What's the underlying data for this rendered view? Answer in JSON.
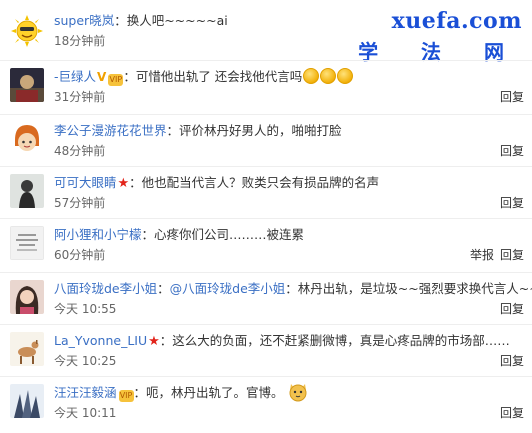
{
  "watermark": {
    "domain": "xuefa.com",
    "chars": "学 法 网"
  },
  "comments": [
    {
      "user": "super晓岚",
      "text": "：换人吧~~~~~ai",
      "time": "18分钟前",
      "reply": "",
      "report": ""
    },
    {
      "user": "-巨绿人",
      "text": "：可惜他出轨了 还会找他代言吗",
      "time": "31分钟前",
      "reply": "回复",
      "report": ""
    },
    {
      "user": "李公子漫游花花世界",
      "text": "：评价林丹好男人的，啪啪打脸",
      "time": "48分钟前",
      "reply": "回复",
      "report": ""
    },
    {
      "user": "可可大眼睛",
      "text": "：他也配当代言人？败类只会有损品牌的名声",
      "time": "57分钟前",
      "reply": "回复",
      "report": ""
    },
    {
      "user": "阿小狸和小宁檬",
      "text": "：心疼你们公司………被连累",
      "time": "60分钟前",
      "reply": "回复",
      "report": "举报"
    },
    {
      "user": "八面玲珑de李小姐",
      "mention": "@八面玲珑de李小姐",
      "text": "：林丹出轨，是垃圾~~强烈要求换代言人~~",
      "time": "今天 10:55",
      "reply": "回复",
      "report": ""
    },
    {
      "user": "La_Yvonne_LIU",
      "text": "：这么大的负面，还不赶紧删微博，真是心疼品牌的市场部……",
      "time": "今天 10:25",
      "reply": "回复",
      "report": ""
    },
    {
      "user": "汪汪汪毅涵",
      "text": "：呃，林丹出轨了。官博。",
      "time": "今天 10:11",
      "reply": "回复",
      "report": ""
    }
  ],
  "badges": {
    "crown_text": "VIP"
  },
  "colors": {
    "username": "#3a6fc4",
    "watermark": "#1a4fd6",
    "star": "#e2231a"
  }
}
